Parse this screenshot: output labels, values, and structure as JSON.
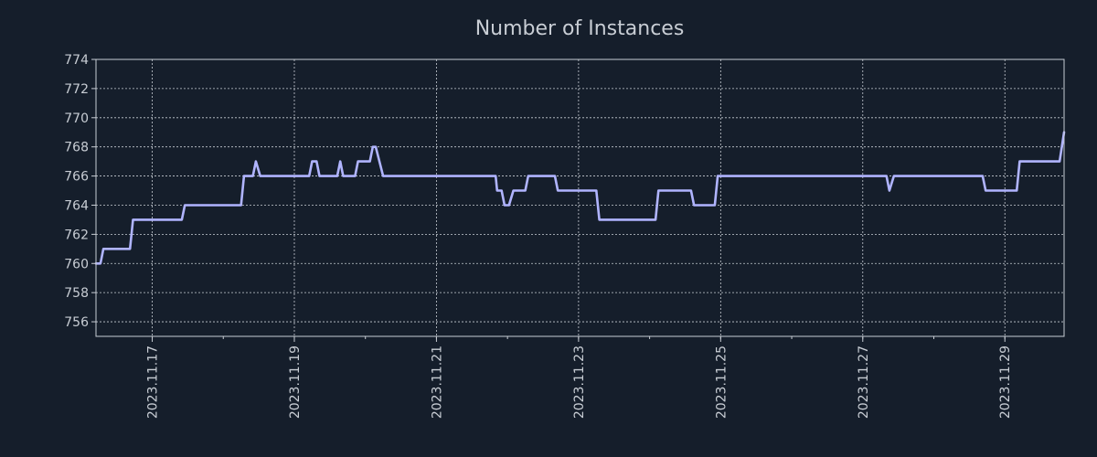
{
  "colors": {
    "background": "#151e2b",
    "text": "#c8cdd4",
    "axis": "#c8cdd4",
    "grid": "#c8cdd4",
    "line": "#b0b4ff"
  },
  "chart_data": {
    "type": "line",
    "title": "Number of Instances",
    "xlabel": "",
    "ylabel": "",
    "grid": true,
    "legend": "none",
    "ylim": [
      755,
      774
    ],
    "xlim": [
      "2023.11.16 05:00",
      "2023.11.29 20:00"
    ],
    "yticks": [
      756,
      758,
      760,
      762,
      764,
      766,
      768,
      770,
      772,
      774
    ],
    "xticks": [
      "2023.11.17",
      "2023.11.19",
      "2023.11.21",
      "2023.11.23",
      "2023.11.25",
      "2023.11.27",
      "2023.11.29"
    ],
    "series": [
      {
        "name": "",
        "points": [
          [
            "2023.11.16 05:00",
            760
          ],
          [
            "2023.11.16 06:30",
            760
          ],
          [
            "2023.11.16 07:30",
            761
          ],
          [
            "2023.11.16 16:30",
            761
          ],
          [
            "2023.11.16 17:30",
            763
          ],
          [
            "2023.11.17 10:00",
            763
          ],
          [
            "2023.11.17 11:00",
            764
          ],
          [
            "2023.11.18 06:00",
            764
          ],
          [
            "2023.11.18 07:00",
            766
          ],
          [
            "2023.11.18 10:00",
            766
          ],
          [
            "2023.11.18 11:00",
            767
          ],
          [
            "2023.11.18 12:30",
            766
          ],
          [
            "2023.11.19 05:00",
            766
          ],
          [
            "2023.11.19 06:00",
            767
          ],
          [
            "2023.11.19 07:30",
            767
          ],
          [
            "2023.11.19 08:30",
            766
          ],
          [
            "2023.11.19 14:30",
            766
          ],
          [
            "2023.11.19 15:30",
            767
          ],
          [
            "2023.11.19 16:30",
            766
          ],
          [
            "2023.11.19 20:30",
            766
          ],
          [
            "2023.11.19 21:30",
            767
          ],
          [
            "2023.11.20 01:30",
            767
          ],
          [
            "2023.11.20 02:30",
            768
          ],
          [
            "2023.11.20 03:30",
            768
          ],
          [
            "2023.11.20 06:00",
            766
          ],
          [
            "2023.11.21 20:00",
            766
          ],
          [
            "2023.11.21 20:30",
            765
          ],
          [
            "2023.11.21 22:00",
            765
          ],
          [
            "2023.11.21 23:00",
            764
          ],
          [
            "2023.11.22 00:30",
            764
          ],
          [
            "2023.11.22 02:00",
            765
          ],
          [
            "2023.11.22 06:00",
            765
          ],
          [
            "2023.11.22 07:00",
            766
          ],
          [
            "2023.11.22 16:00",
            766
          ],
          [
            "2023.11.22 17:00",
            765
          ],
          [
            "2023.11.23 06:00",
            765
          ],
          [
            "2023.11.23 07:00",
            763
          ],
          [
            "2023.11.24 02:00",
            763
          ],
          [
            "2023.11.24 03:00",
            765
          ],
          [
            "2023.11.24 14:00",
            765
          ],
          [
            "2023.11.24 15:00",
            764
          ],
          [
            "2023.11.24 22:00",
            764
          ],
          [
            "2023.11.24 23:00",
            766
          ],
          [
            "2023.11.27 08:00",
            766
          ],
          [
            "2023.11.27 09:00",
            765
          ],
          [
            "2023.11.27 10:30",
            766
          ],
          [
            "2023.11.28 16:30",
            766
          ],
          [
            "2023.11.28 17:30",
            765
          ],
          [
            "2023.11.29 04:00",
            765
          ],
          [
            "2023.11.29 05:00",
            767
          ],
          [
            "2023.11.29 18:30",
            767
          ],
          [
            "2023.11.29 20:00",
            769
          ]
        ]
      }
    ]
  }
}
